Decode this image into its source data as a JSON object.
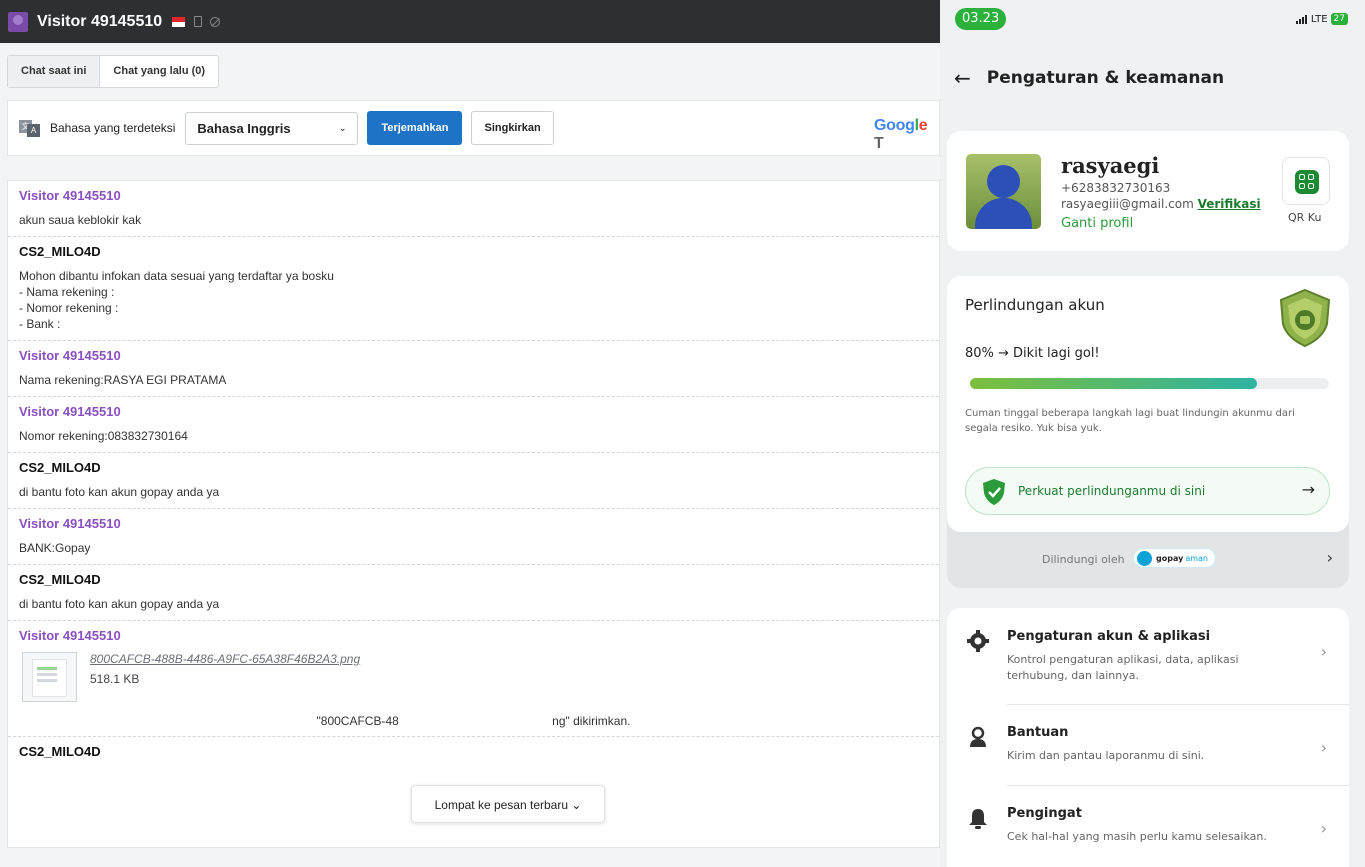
{
  "chat": {
    "visitor_title": "Visitor 49145510",
    "tabs": [
      "Chat saat ini",
      "Chat yang lalu (0)"
    ],
    "translate": {
      "detected_label": "Bahasa yang terdeteksi",
      "selected_language": "Bahasa Inggris",
      "translate_button": "Terjemahkan",
      "dismiss_button": "Singkirkan",
      "google_brand": [
        "Goo",
        "g",
        "l",
        "e",
        " T"
      ]
    },
    "messages": [
      {
        "sender": "Visitor 49145510",
        "role": "visitor",
        "text": [
          "akun saua keblokir kak"
        ]
      },
      {
        "sender": "CS2_MILO4D",
        "role": "agent",
        "text": [
          "Mohon dibantu infokan data sesuai yang terdaftar ya bosku",
          "- Nama rekening :",
          "- Nomor rekening :",
          "- Bank :"
        ]
      },
      {
        "sender": "Visitor 49145510",
        "role": "visitor",
        "text": [
          "Nama rekening:RASYA EGI PRATAMA"
        ]
      },
      {
        "sender": "Visitor 49145510",
        "role": "visitor",
        "text": [
          "Nomor rekening:083832730164"
        ]
      },
      {
        "sender": "CS2_MILO4D",
        "role": "agent",
        "text": [
          "di bantu foto kan akun gopay anda ya"
        ]
      },
      {
        "sender": "Visitor 49145510",
        "role": "visitor",
        "text": [
          "BANK:Gopay"
        ]
      },
      {
        "sender": "CS2_MILO4D",
        "role": "agent",
        "text": [
          "di bantu foto kan akun gopay anda ya"
        ]
      }
    ],
    "file_message": {
      "sender": "Visitor 49145510",
      "file_name": "800CAFCB-488B-4486-A9FC-65A38F46B2A3.png",
      "file_size": "518.1 KB",
      "sent_note": "\"800CAFCB-48                                              ng\" dikirimkan."
    },
    "next_sender_partial": "CS2_MILO4D",
    "jump_button": "Lompat ke pesan terbaru ⌄"
  },
  "phone": {
    "status": {
      "time": "03.23",
      "network": "LTE",
      "battery": "27"
    },
    "header_title": "Pengaturan & keamanan",
    "profile": {
      "name": "rasyaegi",
      "phone": "+6283832730163",
      "email": "rasyaegiii@gmail.com",
      "verify_label": "Verifikasi",
      "change_profile": "Ganti profil",
      "qr_label": "QR Ku"
    },
    "protection": {
      "title": "Perlindungan akun",
      "progress_text": "80% → Dikit lagi gol!",
      "progress_percent": 80,
      "description": "Cuman tinggal beberapa langkah lagi buat lindungin akunmu dari segala resiko. Yuk bisa yuk.",
      "cta": "Perkuat perlindunganmu di sini",
      "protected_by": "Dilindungi oleh",
      "badge_brand": "gopay",
      "badge_aman": "aman"
    },
    "menu": [
      {
        "title": "Pengaturan akun & aplikasi",
        "desc": "Kontrol pengaturan aplikasi, data, aplikasi terhubung, dan lainnya."
      },
      {
        "title": "Bantuan",
        "desc": "Kirim dan pantau laporanmu di sini."
      },
      {
        "title": "Pengingat",
        "desc": "Cek hal-hal yang masih perlu kamu selesaikan."
      }
    ]
  }
}
